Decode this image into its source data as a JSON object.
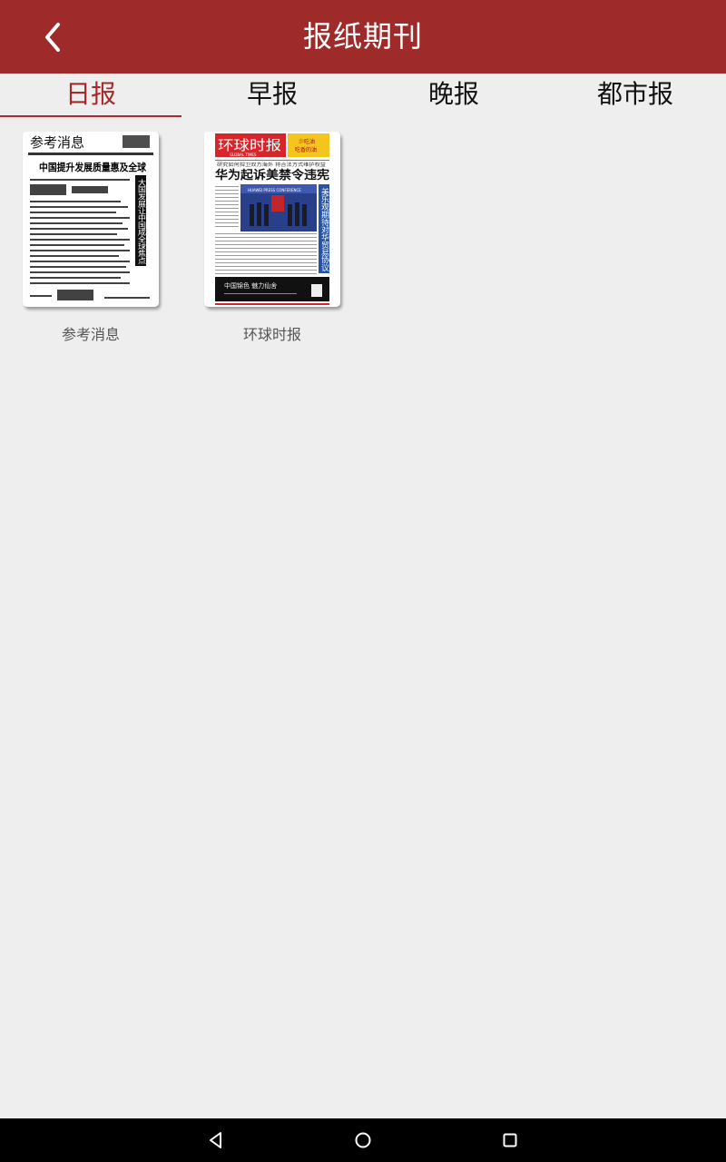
{
  "appbar": {
    "title": "报纸期刊",
    "back_icon": "chevron-left-icon",
    "background": "#9e2a2a"
  },
  "tabs": [
    {
      "label": "日报",
      "active": true
    },
    {
      "label": "早报",
      "active": false
    },
    {
      "label": "晚报",
      "active": false
    },
    {
      "label": "都市报",
      "active": false
    }
  ],
  "accent": "#b3282c",
  "papers": [
    {
      "name": "参考消息",
      "cover": {
        "masthead": "参考消息",
        "headline": "中国提升发展质量惠及全球",
        "side_headline": "大国发展让中国成全球焦点"
      }
    },
    {
      "name": "环球时报",
      "cover": {
        "masthead": "环球时报",
        "masthead_en": "GLOBAL TIMES",
        "ad_text_1": "少吃油",
        "ad_text_2": "吃香的油",
        "subhead": "研究如何捍卫双方海外  将合法方式维护权益",
        "headline": "华为起诉美禁令违宪",
        "side_headline": "美乐观期待对华贸易协议",
        "photo_caption": "HUAWEI PRESS CONFERENCE",
        "footer_ad": "中国锦色  魅力仙舍"
      }
    }
  ],
  "navbar": {
    "back_icon": "triangle-back-icon",
    "home_icon": "circle-home-icon",
    "recents_icon": "square-recents-icon"
  }
}
